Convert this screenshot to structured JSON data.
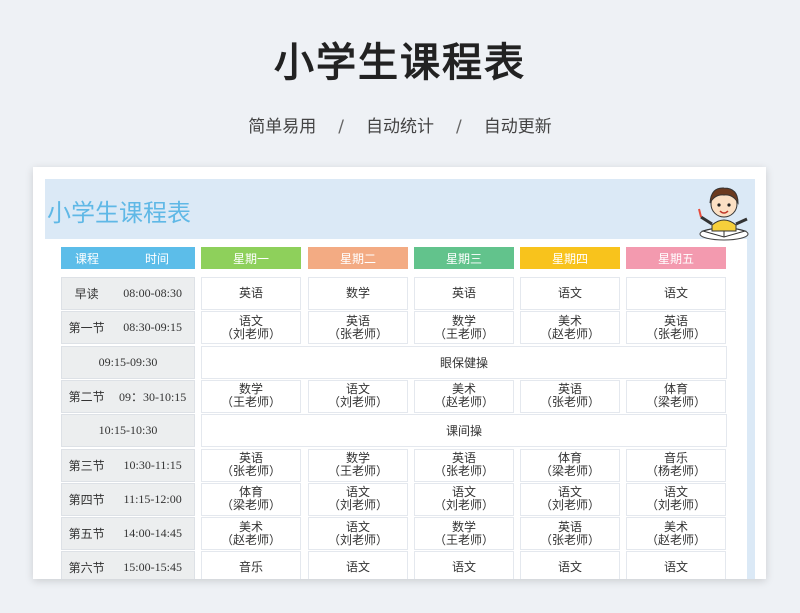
{
  "header": {
    "title": "小学生课程表",
    "features": [
      "简单易用",
      "自动统计",
      "自动更新"
    ],
    "separator": "/"
  },
  "sheet": {
    "title": "小学生课程表",
    "col_headers": {
      "lesson": "课程",
      "time": "时间",
      "days": [
        {
          "label": "星期一",
          "color": "#8ed05b"
        },
        {
          "label": "星期二",
          "color": "#f3ab83"
        },
        {
          "label": "星期三",
          "color": "#62c38c"
        },
        {
          "label": "星期四",
          "color": "#f8c31c"
        },
        {
          "label": "星期五",
          "color": "#f39aaf"
        }
      ]
    },
    "rows": [
      {
        "lesson": "早读",
        "time": "08:00-08:30",
        "cells": [
          [
            "英语",
            ""
          ],
          [
            "数学",
            ""
          ],
          [
            "英语",
            ""
          ],
          [
            "语文",
            ""
          ],
          [
            "语文",
            ""
          ]
        ]
      },
      {
        "lesson": "第一节",
        "time": "08:30-09:15",
        "cells": [
          [
            "语文",
            "（刘老师）"
          ],
          [
            "英语",
            "（张老师）"
          ],
          [
            "数学",
            "（王老师）"
          ],
          [
            "美术",
            "（赵老师）"
          ],
          [
            "英语",
            "（张老师）"
          ]
        ]
      },
      {
        "span_time": "09:15-09:30",
        "span_label": "眼保健操"
      },
      {
        "lesson": "第二节",
        "time": "09：30-10:15",
        "cells": [
          [
            "数学",
            "（王老师）"
          ],
          [
            "语文",
            "（刘老师）"
          ],
          [
            "美术",
            "（赵老师）"
          ],
          [
            "英语",
            "（张老师）"
          ],
          [
            "体育",
            "（梁老师）"
          ]
        ]
      },
      {
        "span_time": "10:15-10:30",
        "span_label": "课间操"
      },
      {
        "lesson": "第三节",
        "time": "10:30-11:15",
        "cells": [
          [
            "英语",
            "（张老师）"
          ],
          [
            "数学",
            "（王老师）"
          ],
          [
            "英语",
            "（张老师）"
          ],
          [
            "体育",
            "（梁老师）"
          ],
          [
            "音乐",
            "（杨老师）"
          ]
        ]
      },
      {
        "lesson": "第四节",
        "time": "11:15-12:00",
        "cells": [
          [
            "体育",
            "（梁老师）"
          ],
          [
            "语文",
            "（刘老师）"
          ],
          [
            "语文",
            "（刘老师）"
          ],
          [
            "语文",
            "（刘老师）"
          ],
          [
            "语文",
            "（刘老师）"
          ]
        ]
      },
      {
        "lesson": "第五节",
        "time": "14:00-14:45",
        "cells": [
          [
            "美术",
            "（赵老师）"
          ],
          [
            "语文",
            "（刘老师）"
          ],
          [
            "数学",
            "（王老师）"
          ],
          [
            "英语",
            "（张老师）"
          ],
          [
            "美术",
            "（赵老师）"
          ]
        ]
      },
      {
        "lesson": "第六节",
        "time": "15:00-15:45",
        "cells": [
          [
            "音乐",
            ""
          ],
          [
            "语文",
            ""
          ],
          [
            "语文",
            ""
          ],
          [
            "语文",
            ""
          ],
          [
            "语文",
            ""
          ]
        ]
      }
    ]
  }
}
